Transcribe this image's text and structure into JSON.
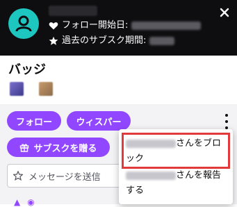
{
  "header": {
    "username_hidden": "",
    "follow_started_label": "フォロー開始日:",
    "past_sub_label": "過去のサブスク期間:",
    "close_icon": "close-icon"
  },
  "badges": {
    "title": "バッジ"
  },
  "actions": {
    "follow_label": "フォロー",
    "whisper_label": "ウィスパー",
    "gift_sub_label": "サブスクを贈る"
  },
  "message": {
    "placeholder": "メッセージを送信"
  },
  "menu": {
    "block_line1": "さんをブロ",
    "block_line2": "ック",
    "report_line1": "さんを報告",
    "report_line2": "する"
  },
  "colors": {
    "header_bg": "#0e0e10",
    "avatar": "#1ec6c0",
    "accent": "#9147ff",
    "highlight": "#e03a3a"
  }
}
